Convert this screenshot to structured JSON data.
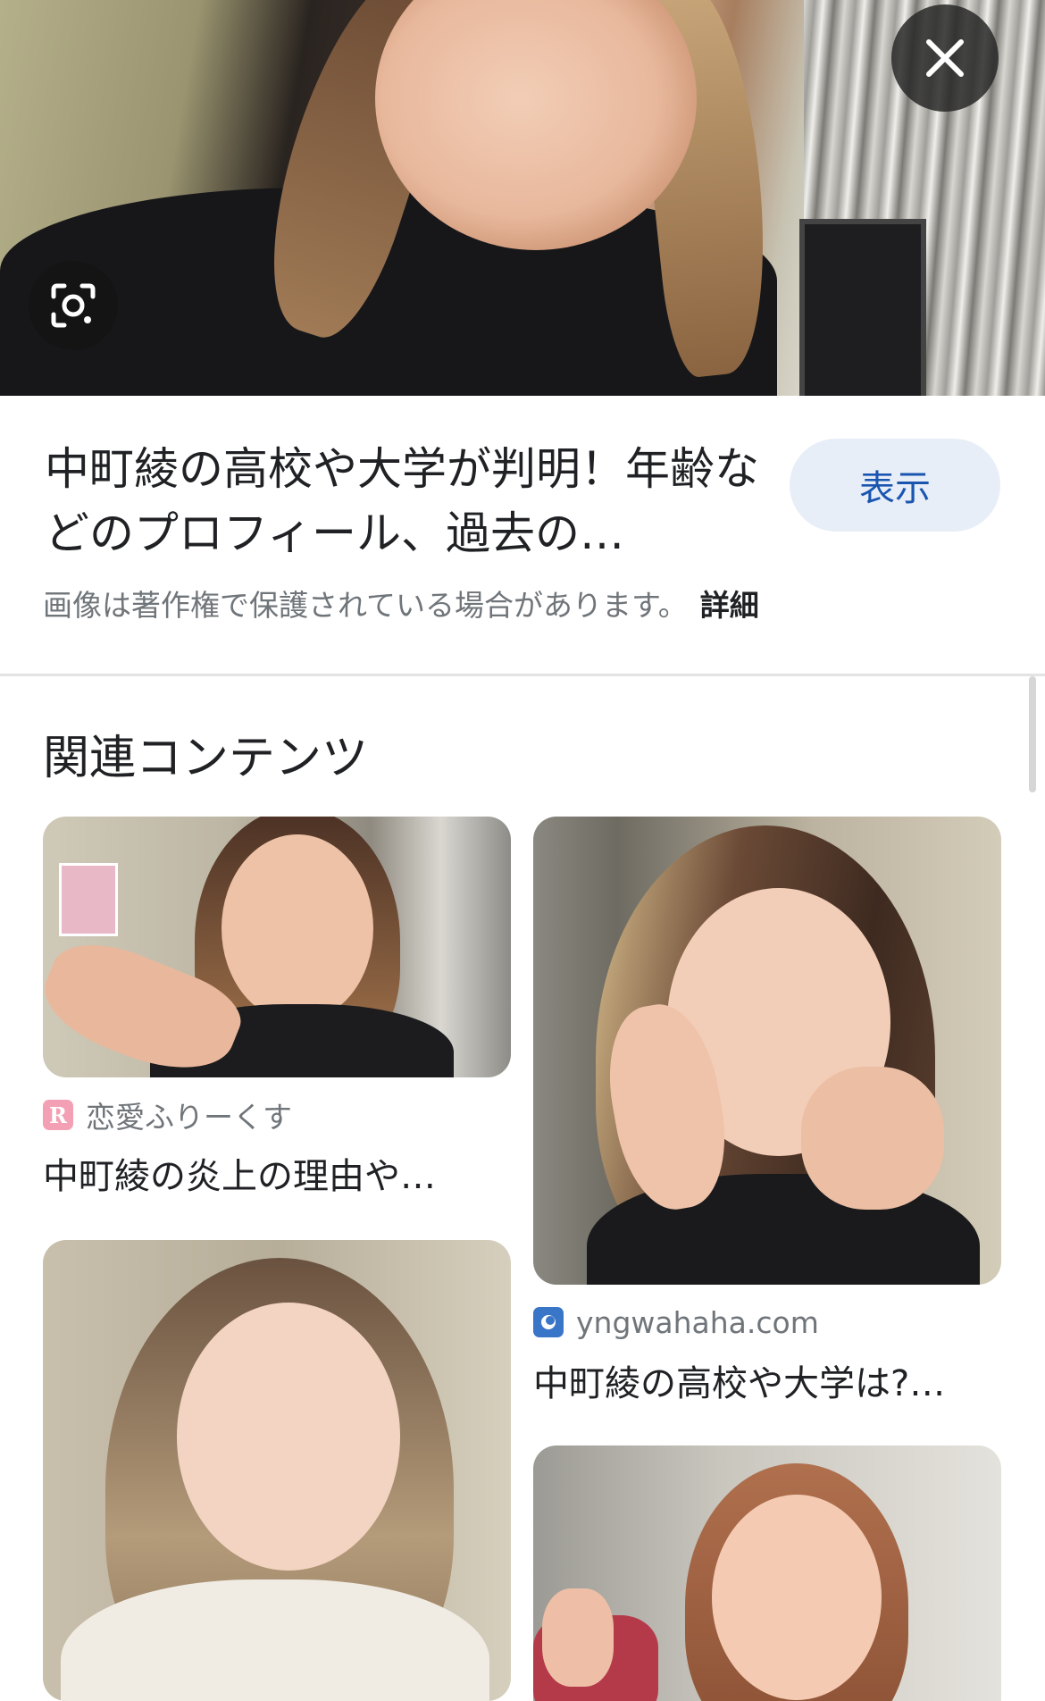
{
  "hero": {
    "close_icon": "close-icon",
    "lens_icon": "lens-search-icon"
  },
  "result": {
    "title": "中町綾の高校や大学が判明！年齢などのプロフィール、過去の…",
    "view_button": "表示",
    "copyright_notice": "画像は著作権で保護されている場合があります。",
    "details_link": "詳細"
  },
  "related": {
    "heading": "関連コンテンツ",
    "items": [
      {
        "source_name": "恋愛ふりーくす",
        "source_icon": "R",
        "source_icon_color": "#f4a0b4",
        "title": "中町綾の炎上の理由や…"
      },
      {
        "source_name": "yngwahaha.com",
        "source_icon": "circle-logo-icon",
        "source_icon_color": "#3a76c8",
        "title": "中町綾の高校や大学は?…"
      },
      {
        "source_name": "",
        "title": ""
      },
      {
        "source_name": "",
        "title": ""
      }
    ]
  }
}
